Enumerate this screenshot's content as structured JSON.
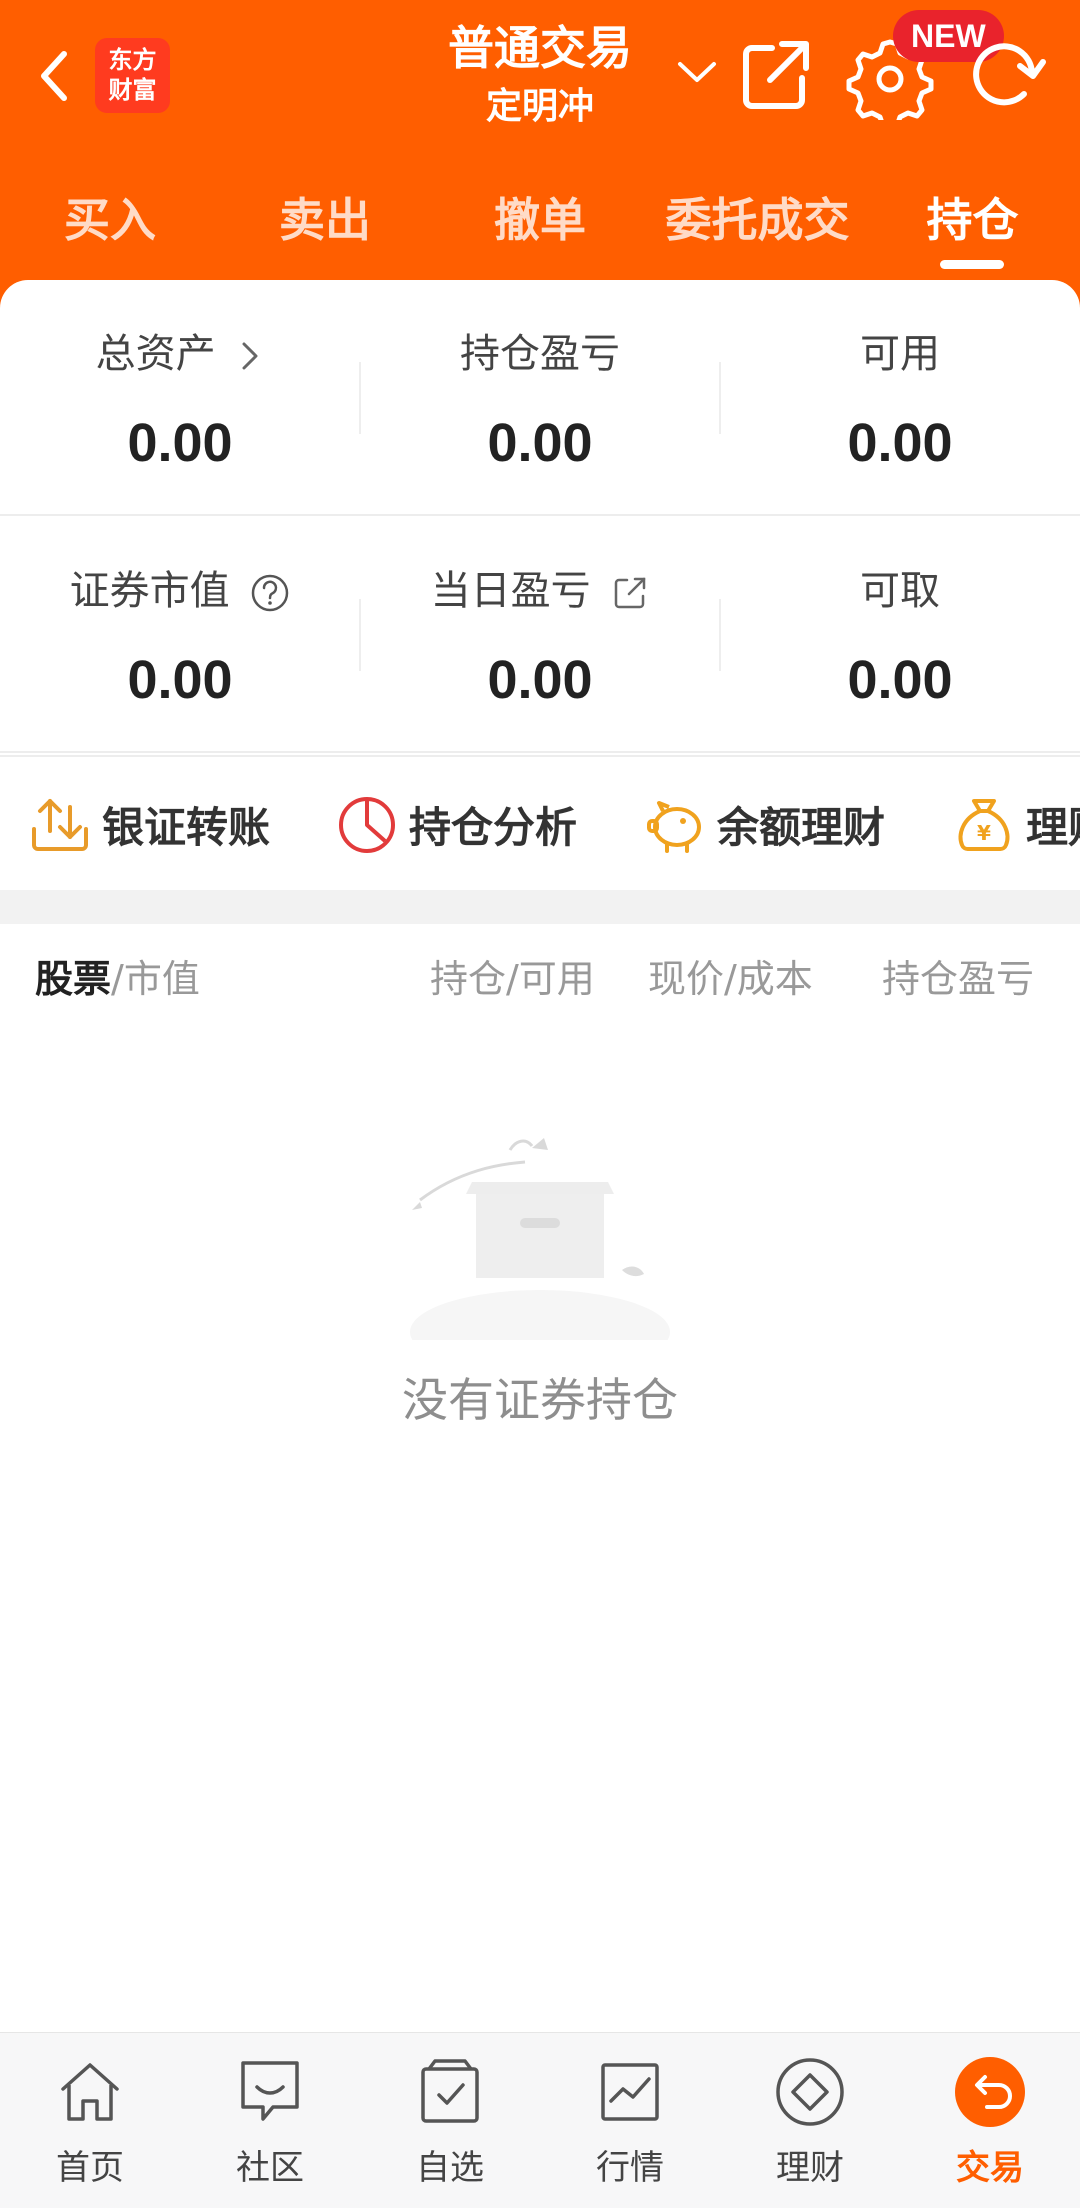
{
  "header": {
    "logo_line1": "东方",
    "logo_line2": "财富",
    "title": "普通交易",
    "subtitle": "定明冲",
    "badge": "NEW"
  },
  "tabs": [
    {
      "label": "买入"
    },
    {
      "label": "卖出"
    },
    {
      "label": "撤单"
    },
    {
      "label": "委托成交"
    },
    {
      "label": "持仓",
      "active": true
    }
  ],
  "summary": {
    "total_assets_label": "总资产",
    "total_assets": "0.00",
    "position_pnl_label": "持仓盈亏",
    "position_pnl": "0.00",
    "available_label": "可用",
    "available": "0.00",
    "market_value_label": "证券市值",
    "market_value": "0.00",
    "daily_pnl_label": "当日盈亏",
    "daily_pnl": "0.00",
    "withdrawable_label": "可取",
    "withdrawable": "0.00"
  },
  "actions": [
    {
      "label": "银证转账",
      "icon": "transfer-icon"
    },
    {
      "label": "持仓分析",
      "icon": "pie-chart-icon"
    },
    {
      "label": "余额理财",
      "icon": "piggy-bank-icon"
    },
    {
      "label": "理财",
      "icon": "money-bag-icon"
    }
  ],
  "holdings_header": {
    "stock": "股票",
    "market_value": "/市值",
    "position": "持仓/可用",
    "price": "现价/成本",
    "pnl": "持仓盈亏"
  },
  "empty_text": "没有证券持仓",
  "bottom_nav": [
    {
      "label": "首页",
      "icon": "home-icon"
    },
    {
      "label": "社区",
      "icon": "chat-icon"
    },
    {
      "label": "自选",
      "icon": "watchlist-icon"
    },
    {
      "label": "行情",
      "icon": "market-chart-icon"
    },
    {
      "label": "理财",
      "icon": "diamond-icon"
    },
    {
      "label": "交易",
      "icon": "trade-icon",
      "active": true
    }
  ],
  "colors": {
    "brand": "#FF5E00",
    "badge": "#E9232C",
    "active_nav": "#FF5E00"
  }
}
